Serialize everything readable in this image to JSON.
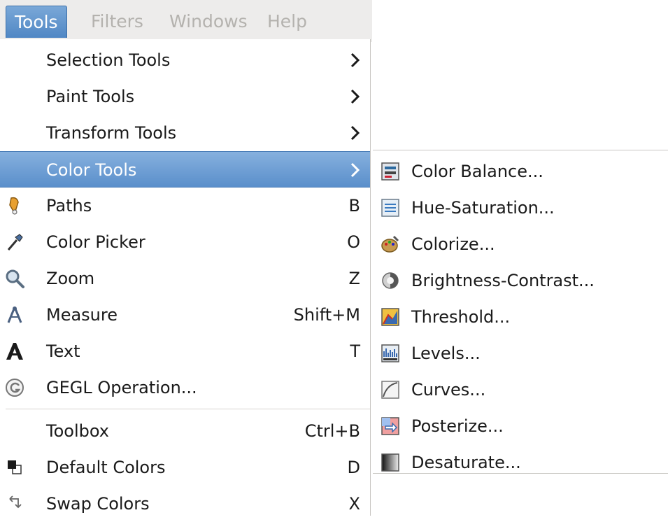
{
  "menubar": {
    "items": [
      {
        "label": "Tools",
        "active": true
      },
      {
        "label": "Filters",
        "active": false
      },
      {
        "label": "Windows",
        "active": false
      },
      {
        "label": "Help",
        "active": false
      }
    ]
  },
  "tools_menu": {
    "items": [
      {
        "label": "Selection Tools",
        "submenu": true
      },
      {
        "label": "Paint Tools",
        "submenu": true
      },
      {
        "label": "Transform Tools",
        "submenu": true
      },
      {
        "label": "Color Tools",
        "submenu": true,
        "selected": true
      },
      {
        "label": "Paths",
        "shortcut": "B",
        "icon": "paths-icon"
      },
      {
        "label": "Color Picker",
        "shortcut": "O",
        "icon": "color-picker-icon"
      },
      {
        "label": "Zoom",
        "shortcut": "Z",
        "icon": "zoom-icon"
      },
      {
        "label": "Measure",
        "shortcut": "Shift+M",
        "icon": "measure-icon"
      },
      {
        "label": "Text",
        "shortcut": "T",
        "icon": "text-icon"
      },
      {
        "label": "GEGL Operation...",
        "icon": "gegl-icon"
      },
      {
        "label": "Toolbox",
        "shortcut": "Ctrl+B"
      },
      {
        "label": "Default Colors",
        "shortcut": "D",
        "icon": "default-colors-icon"
      },
      {
        "label": "Swap Colors",
        "shortcut": "X",
        "icon": "swap-colors-icon"
      }
    ]
  },
  "color_tools_submenu": {
    "items": [
      {
        "label": "Color Balance...",
        "icon": "color-balance-icon"
      },
      {
        "label": "Hue-Saturation...",
        "icon": "hue-saturation-icon"
      },
      {
        "label": "Colorize...",
        "icon": "colorize-icon"
      },
      {
        "label": "Brightness-Contrast...",
        "icon": "brightness-contrast-icon"
      },
      {
        "label": "Threshold...",
        "icon": "threshold-icon"
      },
      {
        "label": "Levels...",
        "icon": "levels-icon"
      },
      {
        "label": "Curves...",
        "icon": "curves-icon"
      },
      {
        "label": "Posterize...",
        "icon": "posterize-icon"
      },
      {
        "label": "Desaturate...",
        "icon": "desaturate-icon"
      }
    ]
  },
  "colors": {
    "selection": "#5a8fcb",
    "disabled_text": "#b4b2ae",
    "text": "#1a1a1a"
  }
}
